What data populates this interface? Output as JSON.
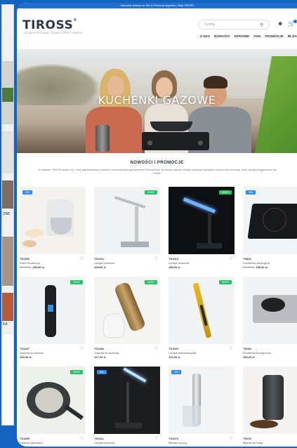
{
  "topbar": {
    "text": "Darmowa dostawa od 150 zł | Promocje tygodnia | Sklep TIROSS"
  },
  "header": {
    "logo": "TIROSS",
    "logo_mark": "®",
    "tagline": "SZYBKA DOSTAWA · NOWOCZESNY DESIGN",
    "search_placeholder": "Szukaj",
    "nav": [
      "O NAS",
      "NOWOŚCI",
      "ZDROWIE",
      "AGD",
      "PROMOCJE",
      "BLOG"
    ]
  },
  "hero": {
    "title": "KUCHENKI GAZOWE"
  },
  "section": {
    "title": "NOWOŚCI I PROMOCJE",
    "description": "W zakładce TIROSS dbamy o to, żeby zaprezentować produkty z nowoczesnym wyposażeniem technicznym. W naszym sklepie możesz zobaczyć wszystkie nowości oraz promocje, które zostały przygotowane dla Ciebie."
  },
  "products": [
    {
      "code": "TS1353",
      "name": "Robot kuchenny",
      "old_price": "349,99 zł",
      "price": "299,99 zł",
      "badge": "30%",
      "badge_type": "sale"
    },
    {
      "code": "TS1012",
      "name": "Lampa biurkowa",
      "old_price": "",
      "price": "209,00 zł",
      "badge": "NOWY",
      "badge_type": "new"
    },
    {
      "code": "TS1014",
      "name": "Lampa biurkowa",
      "old_price": "",
      "price": "189,00 zł",
      "badge": "NOWY",
      "badge_type": "new"
    },
    {
      "code": "TS802",
      "name": "Kuchenka indukcyjna",
      "old_price": "219,00 zł",
      "price": "159,00 zł",
      "badge": "28%",
      "badge_type": "sale"
    },
    {
      "code": "TS1347",
      "name": "Golarka do włosów",
      "old_price": "",
      "price": "159,99 zł",
      "badge": "NOWY",
      "badge_type": "new"
    },
    {
      "code": "TS1346",
      "name": "Golarka do zwierząt",
      "old_price": "",
      "price": "137,00 zł",
      "badge": "NOWY",
      "badge_type": "new"
    },
    {
      "code": "TS1003",
      "name": "Lampa wielofunkcyjna",
      "old_price": "",
      "price": "123,00 zł",
      "badge": "NOWY",
      "badge_type": "new"
    },
    {
      "code": "TS283",
      "name": "Kuchenka turystyczna",
      "old_price": "",
      "price": "159,00 zł",
      "badge": "",
      "badge_type": ""
    },
    {
      "code": "TS1065",
      "name": "Patelnia granitowa",
      "old_price": "",
      "price": "",
      "badge": "NOWY",
      "badge_type": "new"
    },
    {
      "code": "TS1011",
      "name": "Lampa biurkowa",
      "old_price": "",
      "price": "",
      "badge": "30%",
      "badge_type": "sale"
    },
    {
      "code": "TS1370",
      "name": "Blender ręczny",
      "old_price": "",
      "price": "",
      "badge": "30%",
      "badge_type": "sale"
    },
    {
      "code": "TS025",
      "name": "Młynek do kawy",
      "old_price": "",
      "price": "",
      "badge": "",
      "badge_type": ""
    }
  ],
  "left_panel": {
    "snippet_1": "ZNE",
    "snippet_2": "KA"
  },
  "colors": {
    "brand": "#1f6fd1",
    "new_badge": "#2bbf6a",
    "sale_badge": "#2f8cf0",
    "frame": "#1565c0"
  }
}
